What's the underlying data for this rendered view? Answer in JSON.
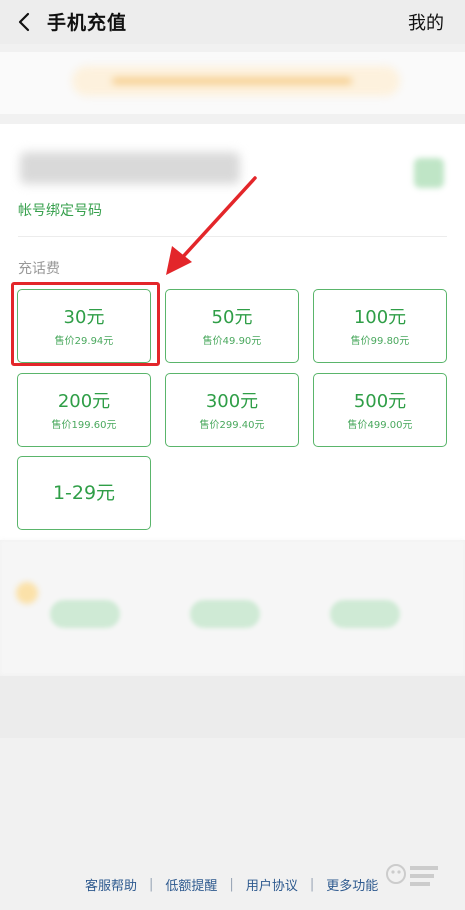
{
  "header": {
    "title": "手机充值",
    "right_action": "我的"
  },
  "account": {
    "bind_link": "帐号绑定号码"
  },
  "recharge": {
    "section_label": "充话费",
    "options": [
      {
        "amount": "30元",
        "price": "售价29.94元"
      },
      {
        "amount": "50元",
        "price": "售价49.90元"
      },
      {
        "amount": "100元",
        "price": "售价99.80元"
      },
      {
        "amount": "200元",
        "price": "售价199.60元"
      },
      {
        "amount": "300元",
        "price": "售价299.40元"
      },
      {
        "amount": "500元",
        "price": "售价499.00元"
      },
      {
        "amount": "1-29元",
        "price": ""
      }
    ]
  },
  "footer": {
    "links": [
      "客服帮助",
      "低额提醒",
      "用户协议",
      "更多功能"
    ]
  },
  "colors": {
    "accent": "#2f9e47",
    "highlight": "#e3262a",
    "link": "#2e5a8f"
  }
}
